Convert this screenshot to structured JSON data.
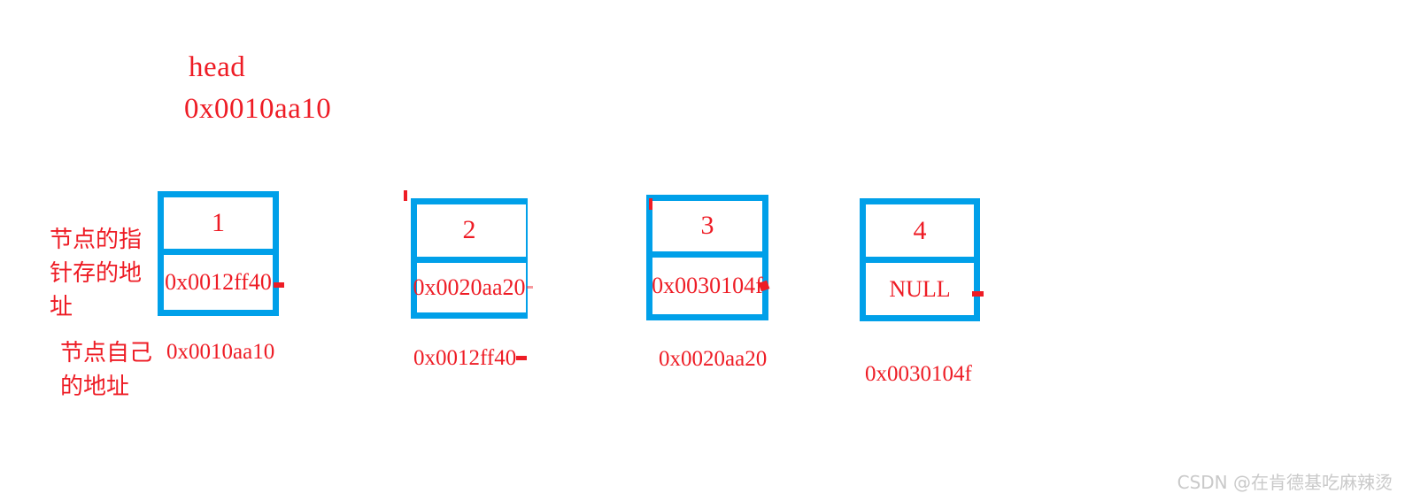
{
  "diagram": {
    "title_head": "head",
    "head_address": "0x0010aa10",
    "annotations": {
      "pointer_address_note": "节点的指针存的地址",
      "self_address_note": "节点自己的地址"
    },
    "nodes": [
      {
        "value": "1",
        "pointer": "0x0012ff40",
        "self_address": "0x0010aa10"
      },
      {
        "value": "2",
        "pointer": "0x0020aa20",
        "self_address": "0x0012ff40"
      },
      {
        "value": "3",
        "pointer": "0x0030104f",
        "self_address": "0x0020aa20"
      },
      {
        "value": "4",
        "pointer": "NULL",
        "self_address": "0x0030104f"
      }
    ],
    "colors": {
      "box_blue": "#00a0e9",
      "text_red": "#ee1c25",
      "watermark_gray": "#c9c9c9",
      "background": "#ffffff"
    },
    "watermark": "CSDN @在肯德基吃麻辣烫"
  }
}
